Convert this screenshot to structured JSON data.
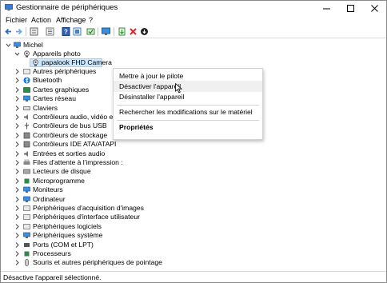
{
  "window": {
    "title": "Gestionnaire de périphériques"
  },
  "menu": [
    "Fichier",
    "Action",
    "Affichage",
    "?"
  ],
  "toolbar": [
    "back-icon",
    "forward-icon",
    "tree-view-icon",
    "properties-icon",
    "help-icon",
    "details-icon",
    "scan-icon",
    "monitor-icon",
    "update-driver-icon",
    "uninstall-icon",
    "disable-icon"
  ],
  "tree": {
    "root": "Michel",
    "expanded_category": "Appareils photo",
    "selected_device": "papalook FHD Camera",
    "categories": [
      "Autres périphériques",
      "Bluetooth",
      "Cartes graphiques",
      "Cartes réseau",
      "Claviers",
      "Contrôleurs audio, vidéo et jeu",
      "Contrôleurs de bus USB",
      "Contrôleurs de stockage",
      "Contrôleurs IDE ATA/ATAPI",
      "Entrées et sorties audio",
      "Files d'attente à l'impression :",
      "Lecteurs de disque",
      "Microprogramme",
      "Moniteurs",
      "Ordinateur",
      "Périphériques d'acquisition d'images",
      "Périphériques d'interface utilisateur",
      "Périphériques logiciels",
      "Périphériques système",
      "Ports (COM et LPT)",
      "Processeurs",
      "Souris et autres périphériques de pointage"
    ]
  },
  "context_menu": {
    "items": [
      "Mettre à jour le pilote",
      "Désactiver l'appareil",
      "Désinstaller l'appareil",
      "Rechercher les modifications sur le matériel",
      "Propriétés"
    ],
    "hovered": "Désactiver l'appareil"
  },
  "status": "Désactive l'appareil sélectionné."
}
